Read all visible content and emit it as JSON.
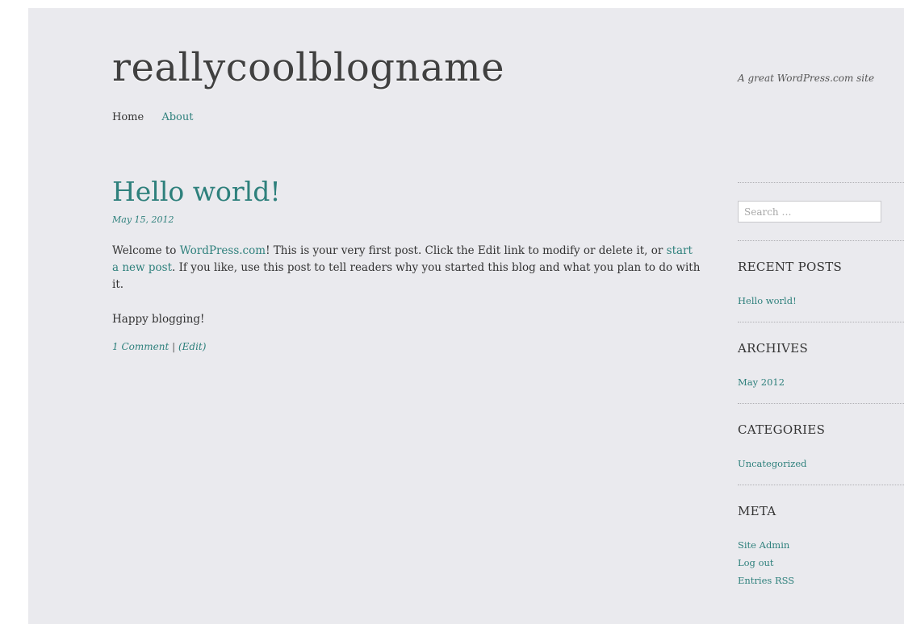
{
  "site": {
    "title": "reallycoolblogname",
    "tagline": "A great WordPress.com site"
  },
  "nav": {
    "home": "Home",
    "about": "About"
  },
  "post": {
    "title": "Hello world!",
    "date": "May 15, 2012",
    "p1_before": "Welcome to ",
    "p1_link1": "WordPress.com",
    "p1_middle": "! This is your very first post. Click the Edit link to modify or delete it, or ",
    "p1_link2": "start a new post",
    "p1_after": ". If you like, use this post to tell readers why you started this blog and what you plan to do with it.",
    "p2": "Happy blogging!",
    "comments_link": "1 Comment",
    "separator": "|",
    "edit_link": "(Edit)"
  },
  "sidebar": {
    "search_placeholder": "Search …",
    "recent_posts": {
      "title": "RECENT POSTS",
      "items": [
        "Hello world!"
      ]
    },
    "archives": {
      "title": "ARCHIVES",
      "items": [
        "May 2012"
      ]
    },
    "categories": {
      "title": "CATEGORIES",
      "items": [
        "Uncategorized"
      ]
    },
    "meta": {
      "title": "META",
      "items": [
        "Site Admin",
        "Log out",
        "Entries RSS"
      ]
    }
  },
  "colors": {
    "accent": "#2e807c",
    "background": "#eaeaee",
    "text": "#333333"
  }
}
